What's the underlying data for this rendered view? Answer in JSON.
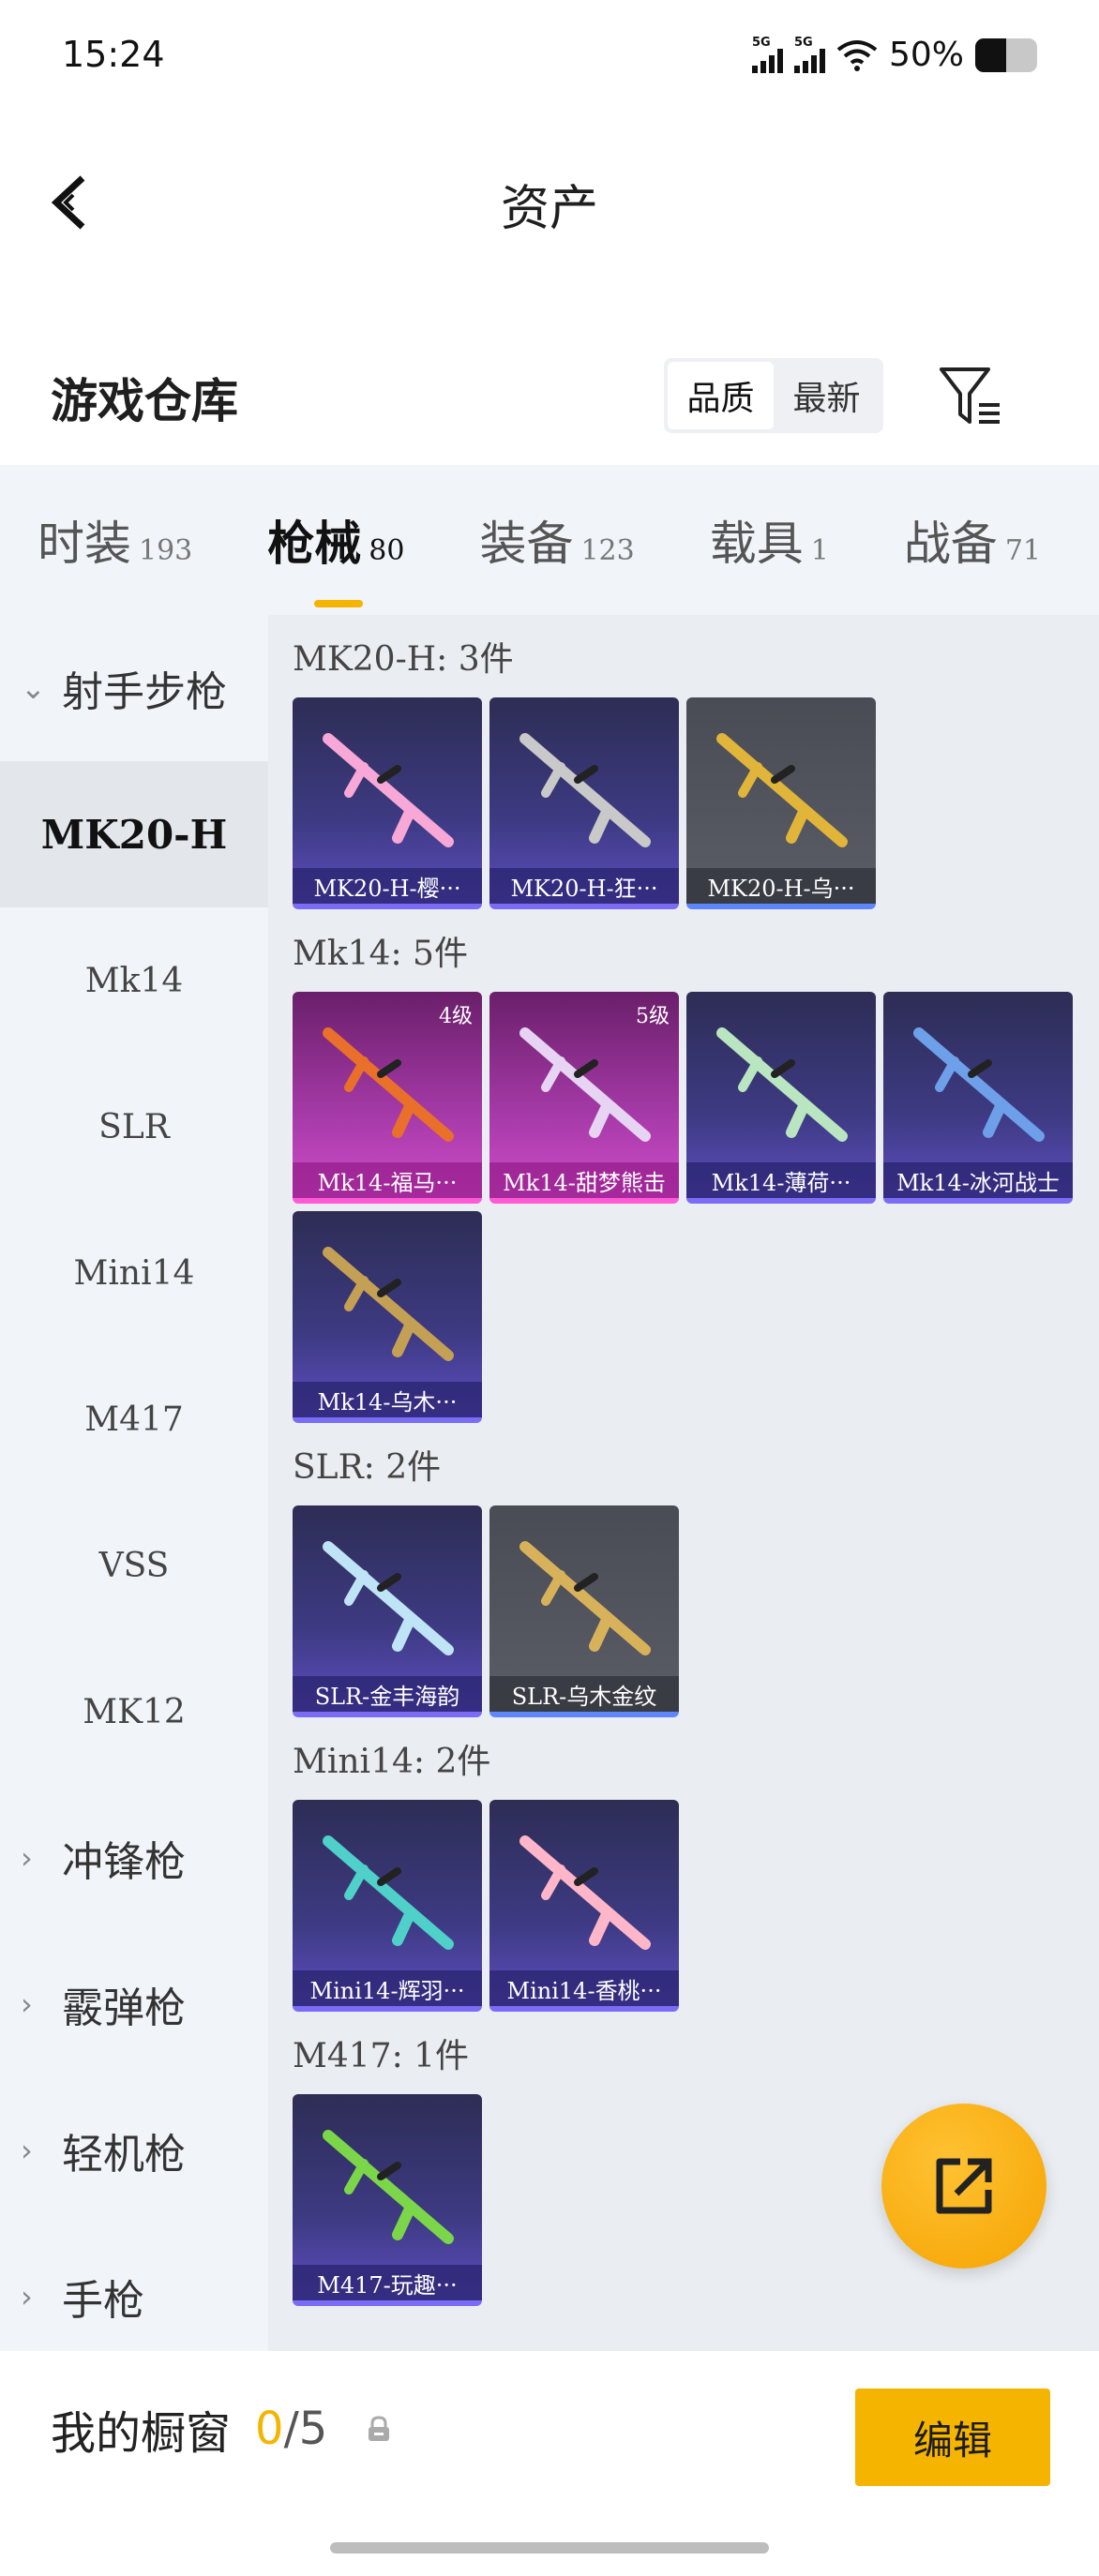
{
  "status": {
    "time": "15:24",
    "net1": "5G",
    "net2": "5G",
    "battery": "50%",
    "battery_level": 0.5
  },
  "header": {
    "title": "资产"
  },
  "warehouse": {
    "title": "游戏仓库",
    "sort_options": [
      "品质",
      "最新"
    ]
  },
  "tabs": [
    {
      "label": "时装",
      "count": "193"
    },
    {
      "label": "枪械",
      "count": "80"
    },
    {
      "label": "装备",
      "count": "123"
    },
    {
      "label": "载具",
      "count": "1"
    },
    {
      "label": "战备",
      "count": "71"
    }
  ],
  "sidebar": {
    "group_open": "射手步枪",
    "items": [
      "MK20-H",
      "Mk14",
      "SLR",
      "Mini14",
      "M417",
      "VSS",
      "MK12"
    ],
    "groups": [
      "冲锋枪",
      "霰弹枪",
      "轻机枪",
      "手枪"
    ]
  },
  "sections": [
    {
      "title": "MK20-H: 3件",
      "cards": [
        {
          "name": "MK20-H-樱···",
          "style": "purple",
          "level": ""
        },
        {
          "name": "MK20-H-狂···",
          "style": "purple",
          "level": ""
        },
        {
          "name": "MK20-H-乌···",
          "style": "gray",
          "level": ""
        }
      ]
    },
    {
      "title": "Mk14: 5件",
      "cards": [
        {
          "name": "Mk14-福马···",
          "style": "pink",
          "level": "4级"
        },
        {
          "name": "Mk14-甜梦熊击",
          "style": "pink",
          "level": "5级"
        },
        {
          "name": "Mk14-薄荷···",
          "style": "purple",
          "level": ""
        },
        {
          "name": "Mk14-冰河战士",
          "style": "purple",
          "level": ""
        },
        {
          "name": "Mk14-乌木···",
          "style": "purple",
          "level": ""
        }
      ]
    },
    {
      "title": "SLR: 2件",
      "cards": [
        {
          "name": "SLR-金丰海韵",
          "style": "purple",
          "level": ""
        },
        {
          "name": "SLR-乌木金纹",
          "style": "gray",
          "level": ""
        }
      ]
    },
    {
      "title": "Mini14: 2件",
      "cards": [
        {
          "name": "Mini14-辉羽···",
          "style": "purple",
          "level": ""
        },
        {
          "name": "Mini14-香桃···",
          "style": "purple",
          "level": ""
        }
      ]
    },
    {
      "title": "M417: 1件",
      "cards": [
        {
          "name": "M417-玩趣···",
          "style": "purple",
          "level": ""
        }
      ]
    }
  ],
  "bottom": {
    "label": "我的橱窗",
    "current": "0",
    "total": "/5",
    "edit": "编辑"
  },
  "icons": {
    "back": "back-arrow-icon",
    "filter": "filter-icon",
    "share": "share-icon",
    "lock": "lock-icon"
  }
}
